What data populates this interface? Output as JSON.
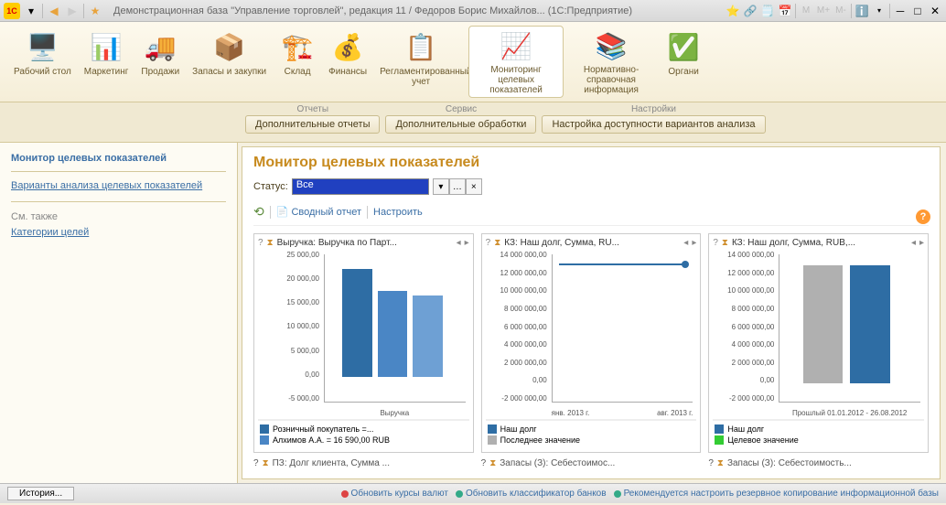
{
  "titlebar": {
    "title": "Демонстрационная база \"Управление торговлей\", редакция 11 / Федоров Борис Михайлов...   (1С:Предприятие)",
    "m_labels": [
      "M",
      "M+",
      "M-"
    ]
  },
  "nav": {
    "items": [
      {
        "label": "Рабочий стол",
        "icon": "🖥️"
      },
      {
        "label": "Маркетинг",
        "icon": "📊"
      },
      {
        "label": "Продажи",
        "icon": "🚚"
      },
      {
        "label": "Запасы и закупки",
        "icon": "📦"
      },
      {
        "label": "Склад",
        "icon": "🏗️"
      },
      {
        "label": "Финансы",
        "icon": "💰"
      },
      {
        "label": "Регламентированный учет",
        "icon": "📋"
      },
      {
        "label": "Мониторинг целевых показателей",
        "icon": "📈"
      },
      {
        "label": "Нормативно-справочная информация",
        "icon": "📚"
      },
      {
        "label": "Органи",
        "icon": "✅"
      }
    ]
  },
  "actions": {
    "groups": [
      {
        "title": "Отчеты",
        "btn": "Дополнительные отчеты"
      },
      {
        "title": "Сервис",
        "btn": "Дополнительные обработки"
      },
      {
        "title": "Настройки",
        "btn": "Настройка доступности вариантов анализа"
      }
    ]
  },
  "sidebar": {
    "title": "Монитор целевых показателей",
    "link1": "Варианты анализа целевых показателей",
    "see_also": "См. также",
    "link2": "Категории целей"
  },
  "content": {
    "heading": "Монитор целевых показателей",
    "status_label": "Статус:",
    "status_value": "Все",
    "toolbar": {
      "refresh": "⟲",
      "report": "Сводный отчет",
      "configure": "Настроить"
    }
  },
  "chart_data": [
    {
      "type": "bar",
      "title": "Выручка: Выручка по Парт...",
      "xlabel": "Выручка",
      "y_ticks": [
        "-5 000,00",
        "0,00",
        "5 000,00",
        "10 000,00",
        "15 000,00",
        "20 000,00",
        "25 000,00"
      ],
      "ylim": [
        -5000,
        25000
      ],
      "categories": [
        "1",
        "2",
        "3"
      ],
      "values": [
        22000,
        17500,
        16590
      ],
      "colors": [
        "#2e6da4",
        "#4a86c5",
        "#6ea0d4"
      ],
      "legend": [
        {
          "label": "Розничный покупатель =...",
          "color": "#2e6da4"
        },
        {
          "label": "Алхимов А.А. = 16 590,00 RUB",
          "color": "#4a86c5"
        }
      ]
    },
    {
      "type": "line",
      "title": "КЗ: Наш долг, Сумма, RU...",
      "y_ticks": [
        "-2 000 000,00",
        "0,00",
        "2 000 000,00",
        "4 000 000,00",
        "6 000 000,00",
        "8 000 000,00",
        "10 000 000,00",
        "12 000 000,00",
        "14 000 000,00"
      ],
      "ylim": [
        -2000000,
        14000000
      ],
      "x_labels": [
        "янв. 2013 г.",
        "авг. 2013 г."
      ],
      "series": [
        {
          "name": "Наш долг",
          "values": [
            12800000,
            12800000
          ],
          "color": "#2e6da4"
        }
      ],
      "legend": [
        {
          "label": "Наш долг",
          "color": "#2e6da4"
        },
        {
          "label": "Последнее значение",
          "color": "#b0b0b0"
        }
      ]
    },
    {
      "type": "bar",
      "title": "КЗ: Наш долг, Сумма, RUB,...",
      "y_ticks": [
        "-2 000 000,00",
        "0,00",
        "2 000 000,00",
        "4 000 000,00",
        "6 000 000,00",
        "8 000 000,00",
        "10 000 000,00",
        "12 000 000,00",
        "14 000 000,00"
      ],
      "ylim": [
        -2000000,
        14000000
      ],
      "xlabel": "Прошлый 01.01.2012 - 26.08.2012",
      "categories": [
        "1",
        "2"
      ],
      "values": [
        12800000,
        12800000
      ],
      "colors": [
        "#b0b0b0",
        "#2e6da4"
      ],
      "legend": [
        {
          "label": "Наш долг",
          "color": "#2e6da4"
        },
        {
          "label": "Целевое значение",
          "color": "#33cc33"
        }
      ]
    }
  ],
  "bottom_widgets": [
    "ПЗ: Долг клиента, Сумма ...",
    "Запасы (З): Себестоимос...",
    "Запасы (З): Себестоимость..."
  ],
  "footer": {
    "history": "История...",
    "link1": "Обновить курсы валют",
    "link2": "Обновить классификатор банков",
    "link3": "Рекомендуется настроить резервное копирование информационной базы"
  }
}
